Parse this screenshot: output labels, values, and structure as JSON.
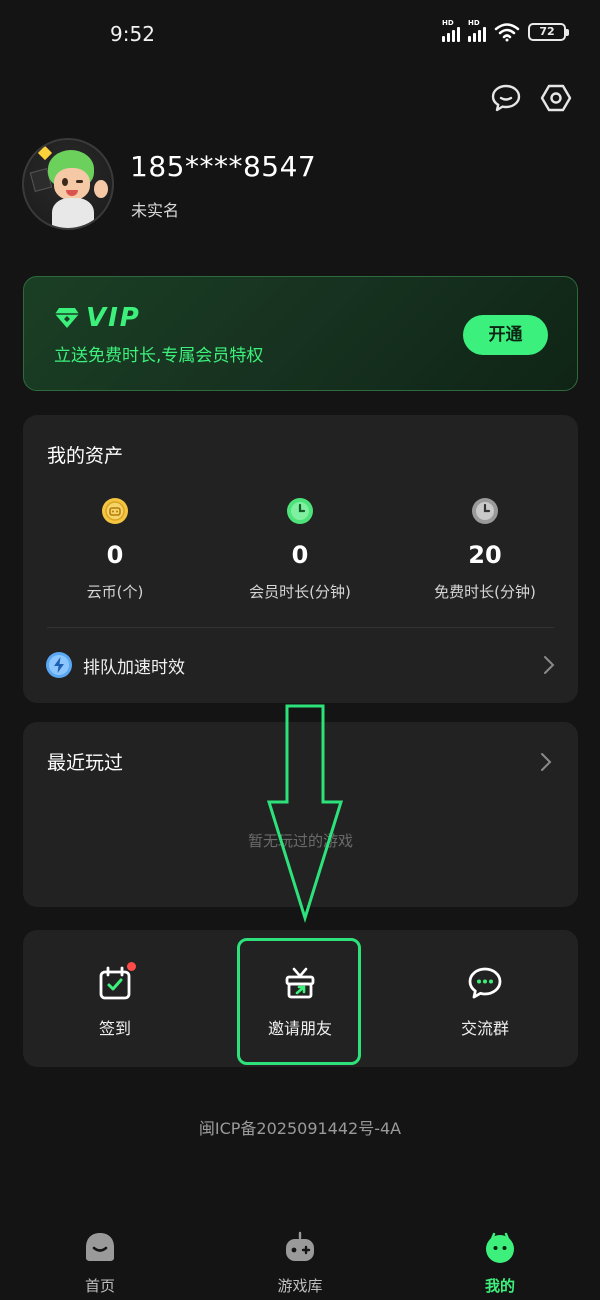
{
  "status_bar": {
    "time": "9:52",
    "signal1_label": "HD",
    "signal2_label": "HD",
    "battery": "72",
    "wifi_icon": "wifi-icon"
  },
  "top_icons": [
    "message-icon",
    "settings-gear-icon"
  ],
  "profile": {
    "phone": "185****8547",
    "verification_status": "未实名"
  },
  "vip": {
    "badge": "VIP",
    "subtitle": "立送免费时长,专属会员特权",
    "button_label": "开通",
    "accent_color": "#3df07b"
  },
  "assets": {
    "title": "我的资产",
    "items": [
      {
        "value": "0",
        "label": "云币(个)",
        "icon": "coin-icon"
      },
      {
        "value": "0",
        "label": "会员时长(分钟)",
        "icon": "clock-green-icon"
      },
      {
        "value": "20",
        "label": "免费时长(分钟)",
        "icon": "clock-gray-icon"
      }
    ],
    "queue_label": "排队加速时效"
  },
  "recent": {
    "title": "最近玩过",
    "empty_text": "暂无玩过的游戏"
  },
  "actions": [
    {
      "label": "签到",
      "icon": "checkin-calendar-icon"
    },
    {
      "label": "邀请朋友",
      "icon": "gift-icon"
    },
    {
      "label": "交流群",
      "icon": "chat-group-icon"
    }
  ],
  "icp": "闽ICP备2025091442号-4A",
  "bottom_nav": [
    {
      "label": "首页",
      "icon": "home-icon"
    },
    {
      "label": "游戏库",
      "icon": "gamepad-icon"
    },
    {
      "label": "我的",
      "icon": "profile-icon"
    }
  ]
}
